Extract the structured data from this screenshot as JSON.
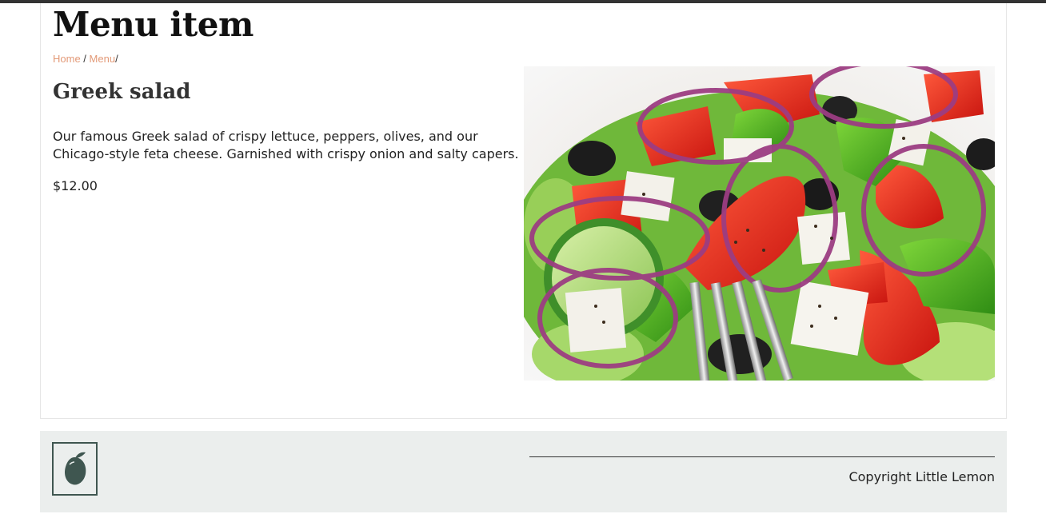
{
  "page": {
    "title": "Menu item"
  },
  "breadcrumb": {
    "home": "Home",
    "menu": "Menu",
    "sep1": " / ",
    "sep2": "/"
  },
  "item": {
    "name": "Greek salad",
    "description": "Our famous Greek salad of crispy lettuce, peppers, olives, and our Chicago-style feta cheese. Garnished with crispy onion and salty capers.",
    "price": "$12.00",
    "image": "greek-salad-photo"
  },
  "footer": {
    "logo": "lemon-logo-icon",
    "copyright": "Copyright Little Lemon"
  },
  "colors": {
    "top_bar": "#333333",
    "link": "#e39a78",
    "footer_bg": "#ebeeed",
    "logo": "#3f5650"
  }
}
